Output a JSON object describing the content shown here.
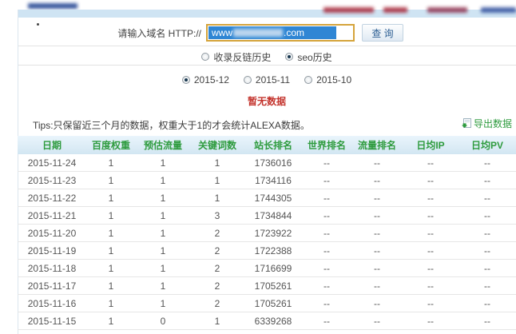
{
  "search": {
    "label": "请输入域名 HTTP://",
    "value_prefix": "www",
    "value_suffix": ".com",
    "button_label": "查 询"
  },
  "history_tabs": {
    "options": [
      {
        "label": "收录反链历史",
        "selected": false
      },
      {
        "label": "seo历史",
        "selected": true
      }
    ]
  },
  "month_tabs": {
    "options": [
      {
        "label": "2015-12",
        "selected": true
      },
      {
        "label": "2015-11",
        "selected": false
      },
      {
        "label": "2015-10",
        "selected": false
      }
    ]
  },
  "empty_message": "暂无数据",
  "tips": "Tips:只保留近三个月的数据，权重大于1的才会统计ALEXA数据。",
  "export_label": "导出数据",
  "table": {
    "headers": [
      "日期",
      "百度权重",
      "预估流量",
      "关键词数",
      "站长排名",
      "世界排名",
      "流量排名",
      "日均IP",
      "日均PV"
    ],
    "rows": [
      [
        "2015-11-24",
        "1",
        "1",
        "1",
        "1736016",
        "--",
        "--",
        "--",
        "--"
      ],
      [
        "2015-11-23",
        "1",
        "1",
        "1",
        "1734116",
        "--",
        "--",
        "--",
        "--"
      ],
      [
        "2015-11-22",
        "1",
        "1",
        "1",
        "1744305",
        "--",
        "--",
        "--",
        "--"
      ],
      [
        "2015-11-21",
        "1",
        "1",
        "3",
        "1734844",
        "--",
        "--",
        "--",
        "--"
      ],
      [
        "2015-11-20",
        "1",
        "1",
        "2",
        "1723922",
        "--",
        "--",
        "--",
        "--"
      ],
      [
        "2015-11-19",
        "1",
        "1",
        "2",
        "1722388",
        "--",
        "--",
        "--",
        "--"
      ],
      [
        "2015-11-18",
        "1",
        "1",
        "2",
        "1716699",
        "--",
        "--",
        "--",
        "--"
      ],
      [
        "2015-11-17",
        "1",
        "1",
        "2",
        "1705261",
        "--",
        "--",
        "--",
        "--"
      ],
      [
        "2015-11-16",
        "1",
        "1",
        "2",
        "1705261",
        "--",
        "--",
        "--",
        "--"
      ],
      [
        "2015-11-15",
        "1",
        "0",
        "1",
        "6339268",
        "--",
        "--",
        "--",
        "--"
      ]
    ]
  },
  "colors": {
    "header_green": "#2e9b3e",
    "empty_red": "#c3322b",
    "selection_blue": "#2f86d4",
    "input_border_gold": "#d5a43b",
    "topbar_blue": "#cfe4f3"
  }
}
